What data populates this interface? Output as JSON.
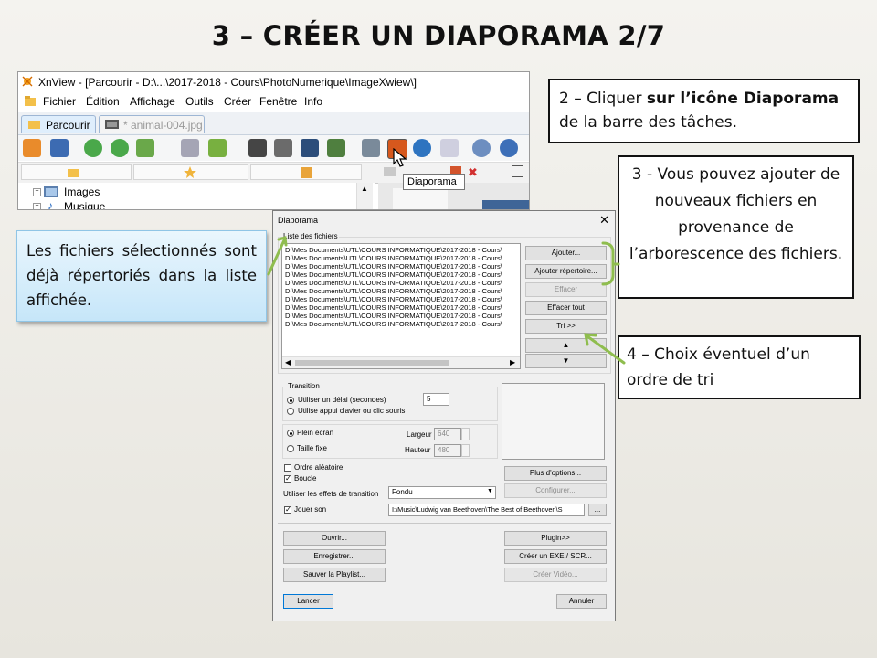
{
  "slide": {
    "title": "3 – CRÉER UN DIAPORAMA 2/7"
  },
  "xnview": {
    "window_title": "XnView - [Parcourir - D:\\...\\2017-2018 - Cours\\PhotoNumerique\\ImageXwiew\\]",
    "menu": [
      "Fichier",
      "Édition",
      "Affichage",
      "Outils",
      "Créer",
      "Fenêtre",
      "Info"
    ],
    "tabs": [
      "Parcourir",
      "* animal-004.jpg"
    ],
    "tree": [
      "Images",
      "Musique"
    ],
    "tooltip": "Diaporama"
  },
  "dialog": {
    "title": "Diaporama",
    "close": "✕",
    "list_group": "Liste des fichiers",
    "files": [
      "D:\\Mes Documents\\UTL\\COURS INFORMATIQUE\\2017-2018 - Cours\\",
      "D:\\Mes Documents\\UTL\\COURS INFORMATIQUE\\2017-2018 - Cours\\",
      "D:\\Mes Documents\\UTL\\COURS INFORMATIQUE\\2017-2018 - Cours\\",
      "D:\\Mes Documents\\UTL\\COURS INFORMATIQUE\\2017-2018 - Cours\\",
      "D:\\Mes Documents\\UTL\\COURS INFORMATIQUE\\2017-2018 - Cours\\",
      "D:\\Mes Documents\\UTL\\COURS INFORMATIQUE\\2017-2018 - Cours\\",
      "D:\\Mes Documents\\UTL\\COURS INFORMATIQUE\\2017-2018 - Cours\\",
      "D:\\Mes Documents\\UTL\\COURS INFORMATIQUE\\2017-2018 - Cours\\",
      "D:\\Mes Documents\\UTL\\COURS INFORMATIQUE\\2017-2018 - Cours\\",
      "D:\\Mes Documents\\UTL\\COURS INFORMATIQUE\\2017-2018 - Cours\\"
    ],
    "buttons": {
      "ajouter": "Ajouter...",
      "ajouter_rep": "Ajouter répertoire...",
      "effacer": "Effacer",
      "effacer_tout": "Effacer tout",
      "tri": "Tri >>",
      "up": "▲",
      "down": "▼",
      "plus_options": "Plus d'options...",
      "configurer": "Configurer...",
      "browse": "...",
      "ouvrir": "Ouvrir...",
      "enregistrer": "Enregistrer...",
      "sauver_playlist": "Sauver la Playlist...",
      "plugin": "Plugin>>",
      "creer_exe": "Créer un EXE / SCR...",
      "creer_video": "Créer Vidéo...",
      "lancer": "Lancer",
      "annuler": "Annuler"
    },
    "transition": {
      "group": "Transition",
      "delay_label": "Utiliser un délai (secondes)",
      "delay_value": "5",
      "keyboard_label": "Utilise appui clavier ou clic souris"
    },
    "display": {
      "plein_ecran": "Plein écran",
      "taille_fixe": "Taille fixe",
      "largeur_label": "Largeur",
      "largeur_value": "640",
      "hauteur_label": "Hauteur",
      "hauteur_value": "480"
    },
    "options": {
      "aleatoire": "Ordre aléatoire",
      "boucle": "Boucle",
      "effets_label": "Utiliser les effets de transition",
      "effets_value": "Fondu",
      "jouer_son": "Jouer son",
      "son_path": "I:\\Music\\Ludwig van Beethoven\\The Best of Beethoven\\S"
    }
  },
  "callouts": {
    "step2_a": "2 – Cliquer ",
    "step2_b": "sur l’icône Diaporama",
    "step2_c": "de la barre des tâches.",
    "step3": "3 - Vous pouvez ajouter de nouveaux fichiers en provenance de l’arborescence des fichiers.",
    "step4": "4 – Choix éventuel d’un ordre de tri",
    "left": "Les fichiers sélectionnés sont déjà répertoriés dans la liste affichée."
  },
  "colors": {
    "arrow": "#8fbd4e",
    "callout_left_bg": "#c6e6f9"
  }
}
